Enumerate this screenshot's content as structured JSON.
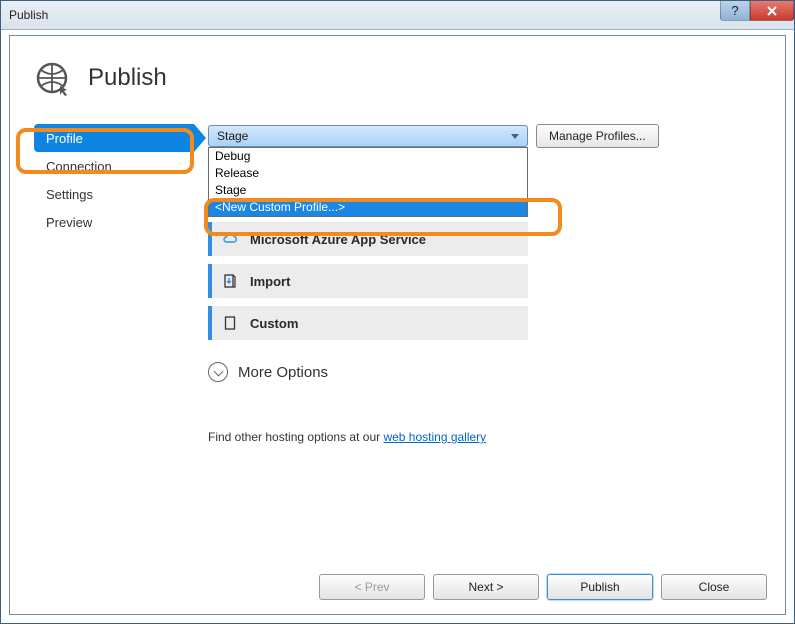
{
  "window": {
    "title": "Publish"
  },
  "header": {
    "title": "Publish"
  },
  "sidebar": {
    "items": [
      {
        "label": "Profile",
        "selected": true
      },
      {
        "label": "Connection",
        "selected": false
      },
      {
        "label": "Settings",
        "selected": false
      },
      {
        "label": "Preview",
        "selected": false
      }
    ]
  },
  "profile": {
    "dropdown": {
      "selected": "Stage",
      "options": [
        "Debug",
        "Release",
        "Stage",
        "<New Custom Profile...>"
      ],
      "highlightedIndex": 3
    },
    "manage_label": "Manage Profiles..."
  },
  "targets": [
    {
      "label": "Microsoft Azure App Service",
      "icon": "cloud-icon"
    },
    {
      "label": "Import",
      "icon": "import-icon"
    },
    {
      "label": "Custom",
      "icon": "document-icon"
    }
  ],
  "more_options": {
    "label": "More Options"
  },
  "hosting": {
    "prefix": "Find other hosting options at our ",
    "link_text": "web hosting gallery"
  },
  "footer": {
    "prev": "< Prev",
    "next": "Next >",
    "publish": "Publish",
    "close": "Close"
  }
}
